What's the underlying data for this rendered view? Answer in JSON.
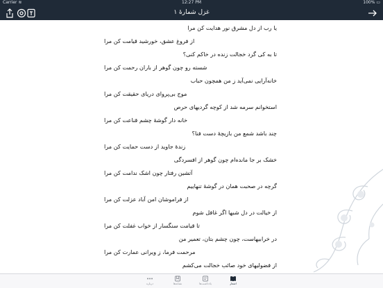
{
  "status_bar": {
    "carrier": "Carrier ≋",
    "time": "12:27 PM",
    "battery": "100% ▭"
  },
  "nav": {
    "title": "غزل شمارهٔ ۱"
  },
  "poem": {
    "lines": [
      "یا رب از دل مشرق نور هدایت کن مرا",
      "از فروغ عشق، خورشید قیامت کن مرا",
      "تا به کی گرد خجالت زنده در خاکم کنی؟",
      "شسته رو چون گوهر از باران رحمت کن مرا",
      "خانه‌آرایی نمی‌آید ز من همچون حباب",
      "موج بی‌پروای دریای حقیقت کن مرا",
      "استخوانم سرمه شد از کوچه گردیهای حرص",
      "خانه دار گوشهٔ چشم قناعت کن مرا",
      "چند باشد شمع من بازیچهٔ دست فنا؟",
      "زندهٔ جاوید از دست حمایت کن مرا",
      "خشک بر جا مانده‌ام چون گوهر از افسردگی",
      "آتشین رفتار چون اشک ندامت کن مرا",
      "گرچه در صحبت همان در گوشهٔ تنهاییم",
      "از فراموشان امن آباد عزلت کن مرا",
      "از خیالت در دل شبها اگر غافل شوم",
      "تا قیامت سنگسار از خواب غفلت کن مرا",
      "در خرابیهاست، چون چشم بتان، تعمیر من",
      "مرحمت فرما، ز ویرانی عمارت کن مرا",
      "از فضولیهای خود صائب خجالت می‌کشم"
    ]
  },
  "tabs": [
    {
      "label": "اشعار",
      "icon": "book-icon",
      "active": true
    },
    {
      "label": "یادداشت‌ها",
      "icon": "note-icon",
      "active": false
    },
    {
      "label": "نشانه‌ها",
      "icon": "bookmark-icon",
      "active": false
    },
    {
      "label": "درباره",
      "icon": "info-icon",
      "active": false
    }
  ],
  "colors": {
    "nav_bg": "#1f2a37",
    "tab_active": "#1f2a37",
    "tab_inactive": "#8a8e95"
  }
}
